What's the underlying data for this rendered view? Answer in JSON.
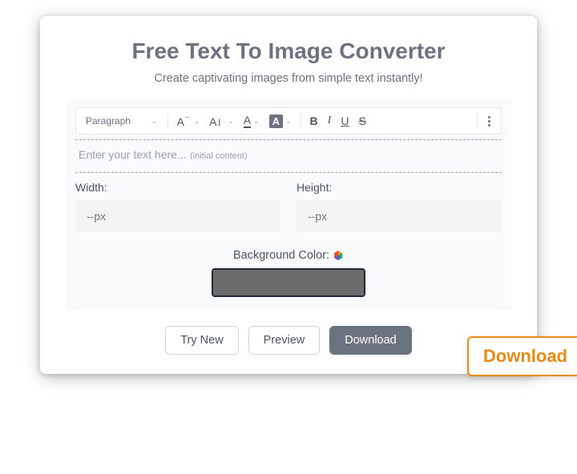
{
  "header": {
    "title": "Free Text To Image Converter",
    "subtitle": "Create captivating images from simple text instantly!"
  },
  "toolbar": {
    "paragraph_label": "Paragraph",
    "font_a": "A",
    "font_dash": "–",
    "font_i": "I",
    "color_a": "A",
    "highlight_a": "A",
    "bold": "B",
    "italic": "I",
    "underline": "U",
    "strike": "S"
  },
  "editor": {
    "placeholder": "Enter your text here...",
    "initial_note": "(initial content)"
  },
  "dims": {
    "width_label": "Width:",
    "height_label": "Height:",
    "px_placeholder": "--px"
  },
  "bg": {
    "label": "Background Color:",
    "color": "#6b6b6b"
  },
  "buttons": {
    "try_new": "Try New",
    "preview": "Preview",
    "download": "Download"
  },
  "callout": {
    "label": "Download"
  }
}
